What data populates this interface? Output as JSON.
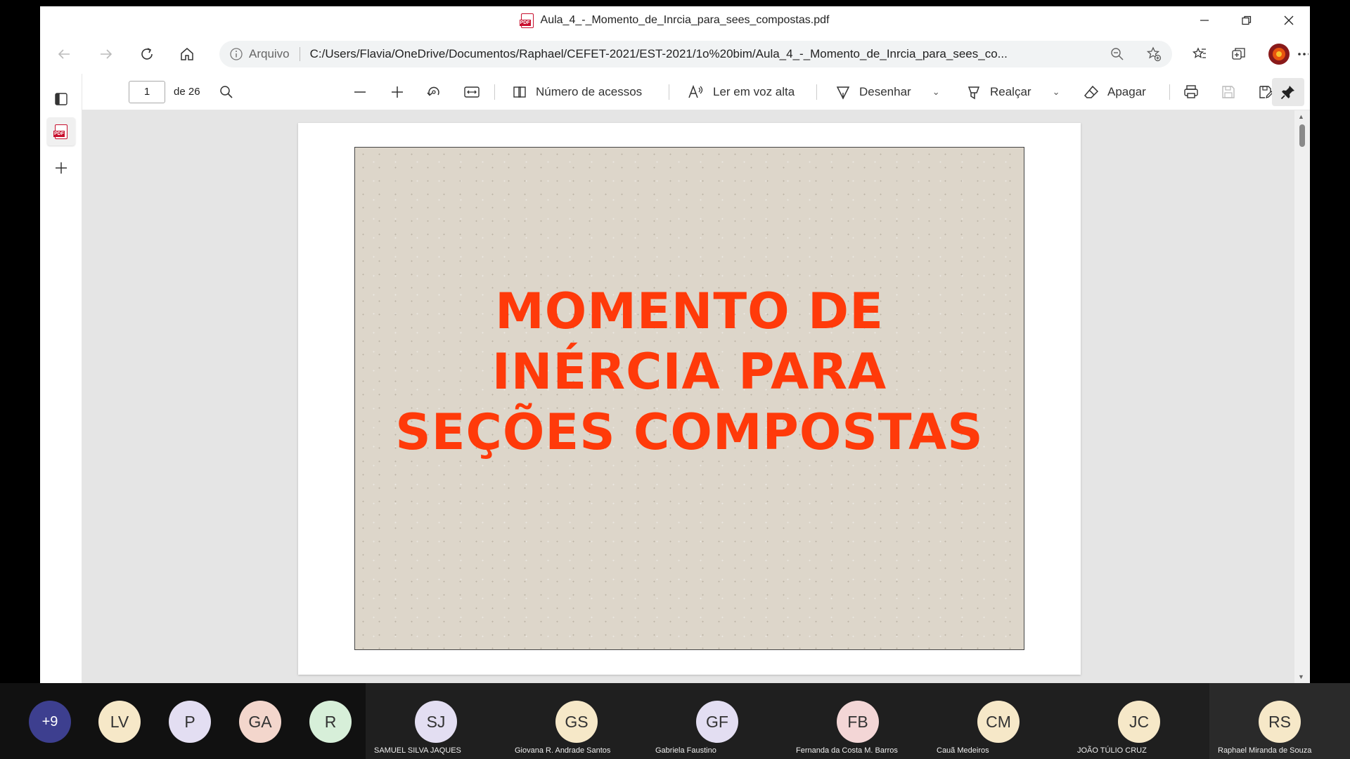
{
  "window": {
    "title": "Aula_4_-_Momento_de_Inrcia_para_sees_compostas.pdf"
  },
  "address": {
    "scheme_label": "Arquivo",
    "url": "C:/Users/Flavia/OneDrive/Documentos/Raphael/CEFET-2021/EST-2021/1o%20bim/Aula_4_-_Momento_de_Inrcia_para_sees_co..."
  },
  "pdf_toolbar": {
    "page_current": "1",
    "page_total": "de 26",
    "access_label": "Número de acessos",
    "read_aloud_label": "Ler em voz alta",
    "draw_label": "Desenhar",
    "highlight_label": "Realçar",
    "erase_label": "Apagar"
  },
  "slide": {
    "title_lines": [
      "MOMENTO DE",
      "INÉRCIA PARA",
      "SEÇÕES COMPOSTAS"
    ],
    "title_color": "#ff3a0a"
  },
  "participants": {
    "more_count": "+9",
    "avatars": [
      {
        "initials": "LV",
        "color": "#f6e8c8"
      },
      {
        "initials": "P",
        "color": "#e3def2"
      },
      {
        "initials": "GA",
        "color": "#f3d6cc"
      },
      {
        "initials": "R",
        "color": "#d7efd9"
      }
    ],
    "tiles": [
      {
        "initials": "SJ",
        "name": "SAMUEL SILVA JAQUES",
        "color": "#e3def2"
      },
      {
        "initials": "GS",
        "name": "Giovana R. Andrade Santos",
        "color": "#f6e8c8"
      },
      {
        "initials": "GF",
        "name": "Gabriela Faustino",
        "color": "#e3def2"
      },
      {
        "initials": "FB",
        "name": "Fernanda da Costa M. Barros",
        "color": "#f3d6d6"
      },
      {
        "initials": "CM",
        "name": "Cauã Medeiros",
        "color": "#f6e8c8"
      },
      {
        "initials": "JC",
        "name": "JOÃO TÚLIO CRUZ",
        "color": "#f6e8c8"
      },
      {
        "initials": "RS",
        "name": "Raphael Miranda de Souza",
        "color": "#f6e8c8"
      }
    ]
  }
}
